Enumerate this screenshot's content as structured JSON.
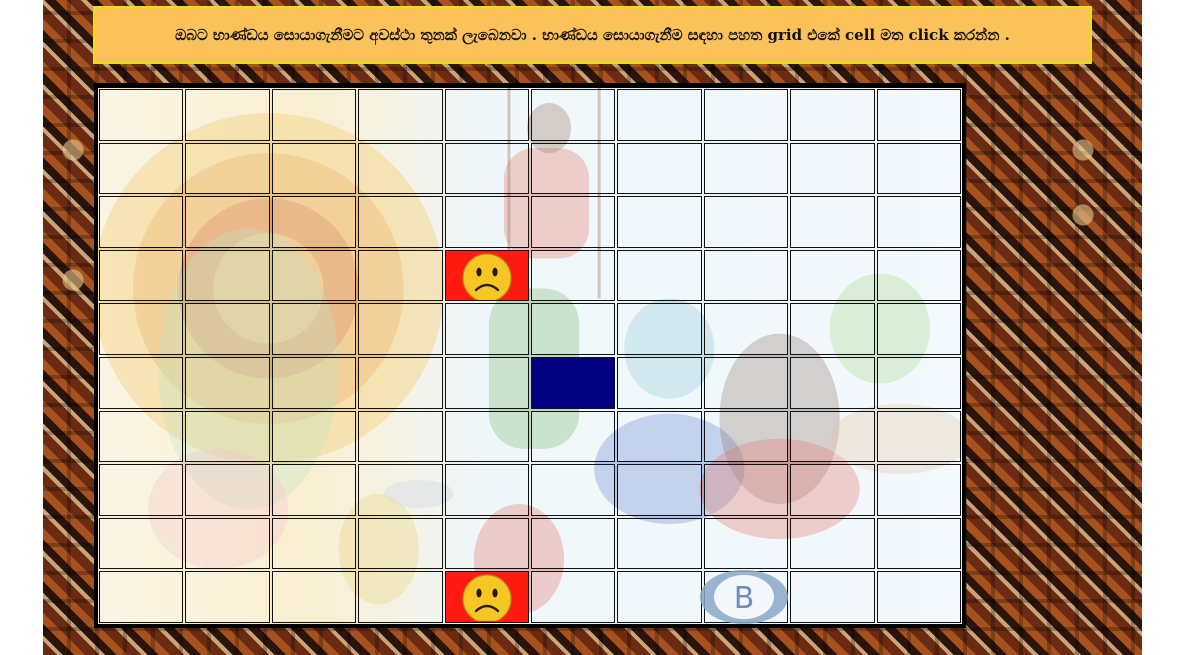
{
  "instruction": {
    "text": "ඔබට භාණ්ඩය සොයාගැනීමට අවස්ථා තුනක් ලැබෙනවා . භාණ්ඩය සොයාගැනීම සඳහා පහත grid එකේ cell මත click කරන්න ."
  },
  "grid": {
    "rows": 10,
    "cols": 10,
    "cells": [
      {
        "row": 3,
        "col": 4,
        "state": "miss",
        "icon": "sad-face-icon"
      },
      {
        "row": 5,
        "col": 5,
        "state": "selected"
      },
      {
        "row": 9,
        "col": 4,
        "state": "miss",
        "icon": "sad-face-icon"
      }
    ]
  },
  "watermark": {
    "letter": "B",
    "icon": "logo-b-icon"
  },
  "colors": {
    "instruction_bg": "#fbc15a",
    "instruction_border": "#e7e012",
    "selected_cell": "#000080",
    "miss_cell": "#ff1a12",
    "face": "#f6c624"
  }
}
